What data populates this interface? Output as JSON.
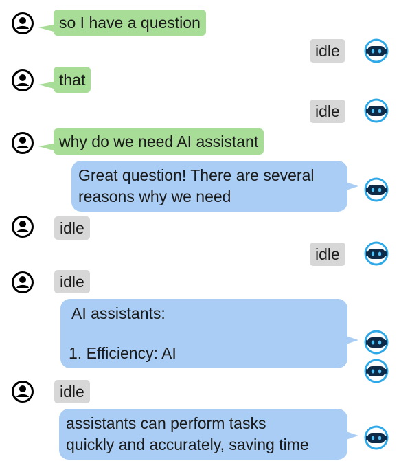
{
  "chat": {
    "messages": [
      {
        "sender": "user",
        "text": "so I have a question"
      },
      {
        "sender": "bot",
        "text": "idle"
      },
      {
        "sender": "user",
        "text": "that"
      },
      {
        "sender": "bot",
        "text": "idle"
      },
      {
        "sender": "user",
        "text": "why do we need AI assistant"
      },
      {
        "sender": "bot",
        "lines": [
          "Great question! There are several",
          "reasons why we need"
        ]
      },
      {
        "sender": "user",
        "text": "idle"
      },
      {
        "sender": "bot",
        "text": "idle"
      },
      {
        "sender": "user",
        "text": "idle"
      },
      {
        "sender": "bot",
        "lines": [
          "AI assistants:",
          "",
          "1. Efficiency: AI"
        ]
      },
      {
        "sender": "user",
        "text": "idle"
      },
      {
        "sender": "bot",
        "lines": [
          "assistants can perform tasks",
          "quickly and accurately, saving time"
        ]
      }
    ]
  },
  "colors": {
    "user_bubble": "#a7dd96",
    "bot_bubble": "#a9cdf4",
    "idle_chip": "#d7d7d7",
    "bot_avatar_ring": "#2fa8e8",
    "bot_avatar_face": "#0e2a47"
  },
  "icons": {
    "user_avatar": "user-silhouette-icon",
    "bot_avatar": "robot-icon"
  }
}
